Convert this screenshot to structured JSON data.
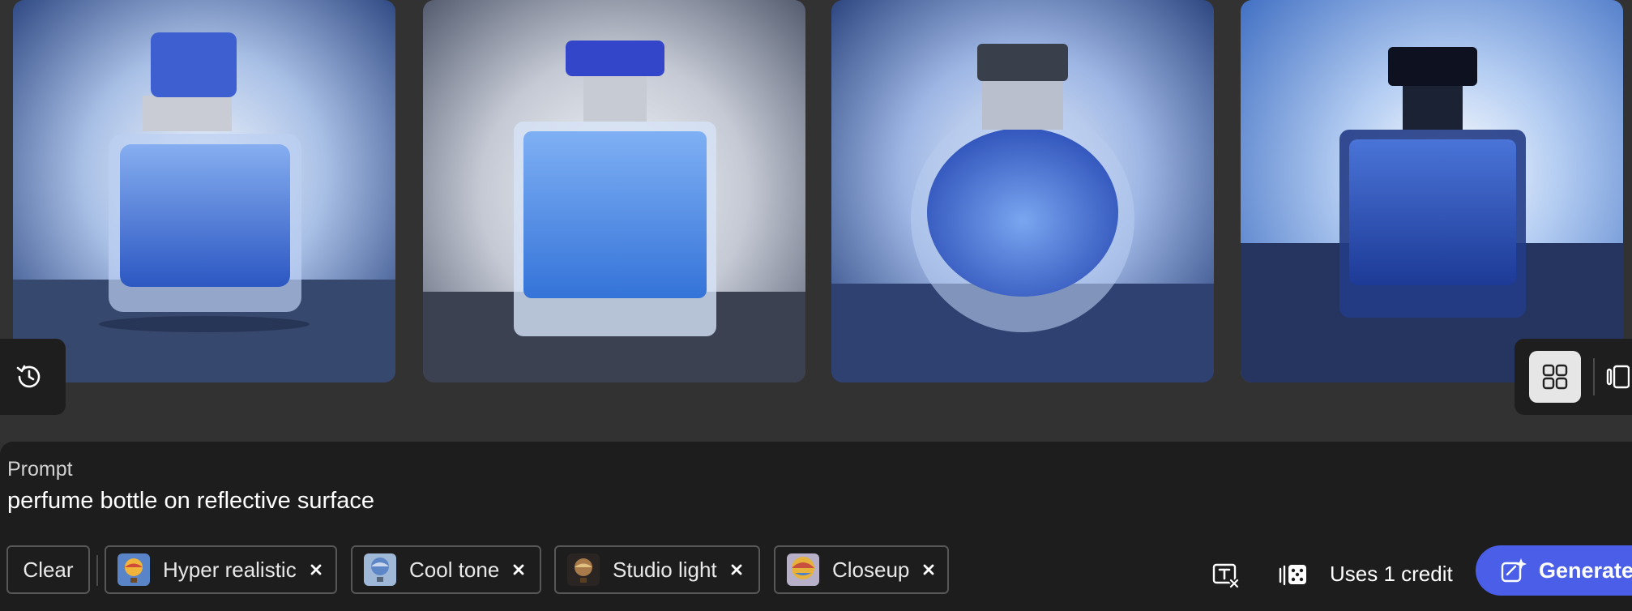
{
  "gallery": {
    "images": [
      {
        "alt": "perfume bottle 1"
      },
      {
        "alt": "perfume bottle 2"
      },
      {
        "alt": "perfume bottle 3"
      },
      {
        "alt": "perfume bottle 4"
      }
    ]
  },
  "prompt": {
    "label": "Prompt",
    "text": "perfume bottle on reflective surface"
  },
  "tags": {
    "clear_label": "Clear",
    "items": [
      {
        "label": "Hyper realistic",
        "thumb_icon": "hot-air-balloon"
      },
      {
        "label": "Cool tone",
        "thumb_icon": "hot-air-balloon"
      },
      {
        "label": "Studio light",
        "thumb_icon": "hot-air-balloon"
      },
      {
        "label": "Closeup",
        "thumb_icon": "hot-air-balloon"
      }
    ]
  },
  "footer": {
    "credits_label": "Uses 1 credit",
    "generate_label": "Generate"
  },
  "icons": {
    "history": "history-icon",
    "grid_view": "grid-view-icon",
    "carousel_view": "carousel-view-icon",
    "text_effects": "text-effects-icon",
    "variation": "variation-dice-icon",
    "generate": "sparkle-generate-icon"
  },
  "colors": {
    "accent": "#4a5ee8",
    "panel": "#1d1d1d",
    "background": "#323232"
  }
}
